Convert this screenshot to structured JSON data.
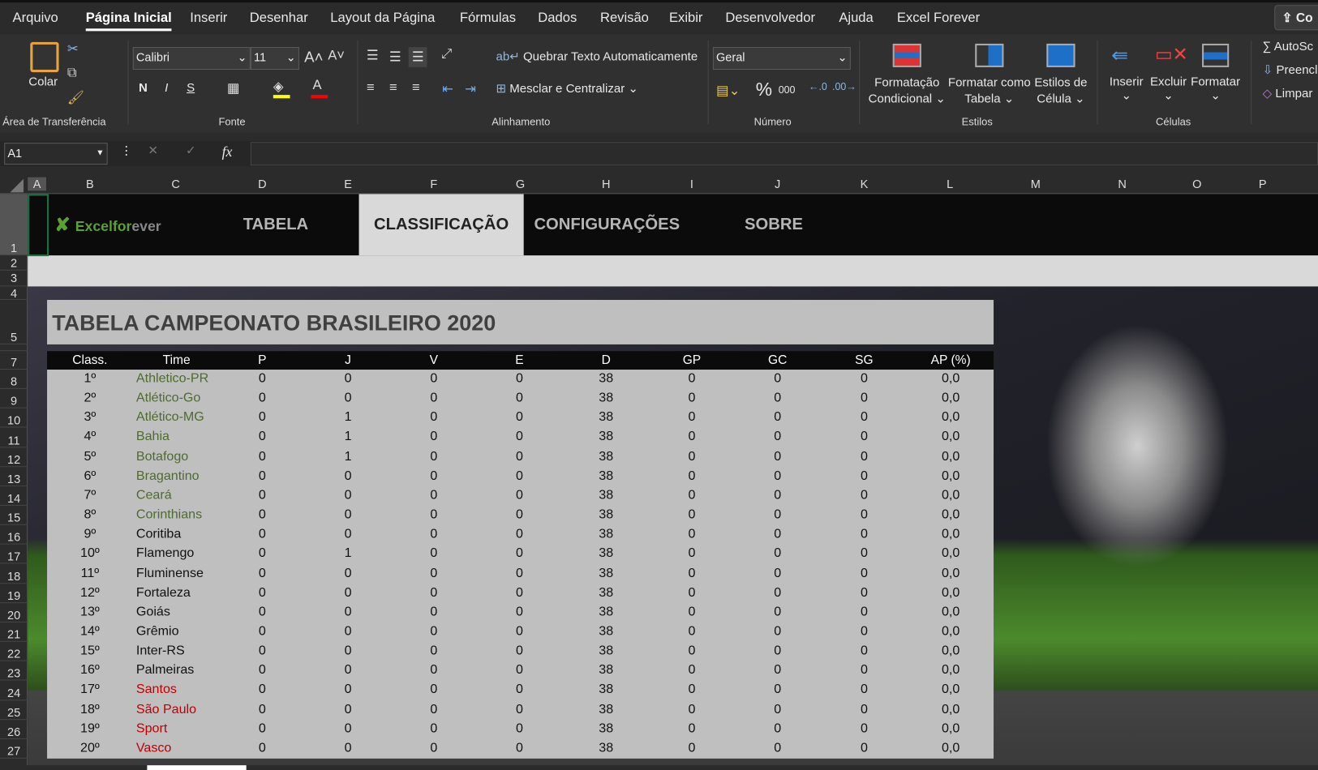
{
  "menu": {
    "items": [
      "Arquivo",
      "Página Inicial",
      "Inserir",
      "Desenhar",
      "Layout da Página",
      "Fórmulas",
      "Dados",
      "Revisão",
      "Exibir",
      "Desenvolvedor",
      "Ajuda",
      "Excel Forever"
    ],
    "active": "Página Inicial",
    "share_label": "Co"
  },
  "ribbon": {
    "clipboard": {
      "paste_label": "Colar",
      "group_label": "Área de Transferência"
    },
    "font": {
      "font_name": "Calibri",
      "font_size": "11",
      "bold": "N",
      "italic": "I",
      "underline": "S",
      "group_label": "Fonte",
      "highlight_color": "#ffff00",
      "font_color": "#ff0000"
    },
    "alignment": {
      "wrap_text": "Quebrar Texto Automaticamente",
      "merge_center": "Mesclar e Centralizar",
      "group_label": "Alinhamento"
    },
    "number": {
      "format": "Geral",
      "percent": "%",
      "thousands": "000",
      "group_label": "Número"
    },
    "styles": {
      "conditional": [
        "Formatação",
        "Condicional"
      ],
      "format_table": [
        "Formatar como",
        "Tabela"
      ],
      "cell_styles": [
        "Estilos de",
        "Célula"
      ],
      "group_label": "Estilos"
    },
    "cells": {
      "insert": "Inserir",
      "delete": "Excluir",
      "format": "Formatar",
      "group_label": "Células"
    },
    "editing": {
      "autosum": "AutoSc",
      "fill": "Preencl",
      "clear": "Limpar"
    }
  },
  "formula_bar": {
    "name_box": "A1",
    "fx": "fx",
    "value": ""
  },
  "columns": [
    "A",
    "B",
    "C",
    "D",
    "E",
    "F",
    "G",
    "H",
    "I",
    "J",
    "K",
    "L",
    "M",
    "N",
    "O",
    "P"
  ],
  "rows": [
    "1",
    "2",
    "3",
    "4",
    "5",
    "",
    "7",
    "8",
    "9",
    "10",
    "11",
    "12",
    "13",
    "14",
    "15",
    "16",
    "17",
    "18",
    "19",
    "20",
    "21",
    "22",
    "23",
    "24",
    "25",
    "26",
    "27"
  ],
  "sheet": {
    "logo": {
      "part1": "Excelfor",
      "part2": "ever"
    },
    "nav": [
      "TABELA",
      "CLASSIFICAÇÃO",
      "CONFIGURAÇÕES",
      "SOBRE"
    ],
    "nav_active": "CLASSIFICAÇÃO",
    "title": "TABELA CAMPEONATO BRASILEIRO 2020",
    "headers": [
      "Class.",
      "Time",
      "P",
      "J",
      "V",
      "E",
      "D",
      "GP",
      "GC",
      "SG",
      "AP (%)"
    ],
    "colors": {
      "green": "#4e6b2e",
      "black": "#111111",
      "red": "#c00000"
    },
    "table": [
      {
        "pos": "1º",
        "team": "Athletico-PR",
        "zone": "green",
        "v": [
          "0",
          "0",
          "0",
          "0",
          "38",
          "0",
          "0",
          "0",
          "0,0"
        ]
      },
      {
        "pos": "2º",
        "team": "Atlético-Go",
        "zone": "green",
        "v": [
          "0",
          "0",
          "0",
          "0",
          "38",
          "0",
          "0",
          "0",
          "0,0"
        ]
      },
      {
        "pos": "3º",
        "team": "Atlético-MG",
        "zone": "green",
        "v": [
          "0",
          "1",
          "0",
          "0",
          "38",
          "0",
          "0",
          "0",
          "0,0"
        ]
      },
      {
        "pos": "4º",
        "team": "Bahia",
        "zone": "green",
        "v": [
          "0",
          "1",
          "0",
          "0",
          "38",
          "0",
          "0",
          "0",
          "0,0"
        ]
      },
      {
        "pos": "5º",
        "team": "Botafogo",
        "zone": "green",
        "v": [
          "0",
          "1",
          "0",
          "0",
          "38",
          "0",
          "0",
          "0",
          "0,0"
        ]
      },
      {
        "pos": "6º",
        "team": "Bragantino",
        "zone": "green",
        "v": [
          "0",
          "0",
          "0",
          "0",
          "38",
          "0",
          "0",
          "0",
          "0,0"
        ]
      },
      {
        "pos": "7º",
        "team": "Ceará",
        "zone": "green",
        "v": [
          "0",
          "0",
          "0",
          "0",
          "38",
          "0",
          "0",
          "0",
          "0,0"
        ]
      },
      {
        "pos": "8º",
        "team": "Corinthians",
        "zone": "green",
        "v": [
          "0",
          "0",
          "0",
          "0",
          "38",
          "0",
          "0",
          "0",
          "0,0"
        ]
      },
      {
        "pos": "9º",
        "team": "Coritiba",
        "zone": "black",
        "v": [
          "0",
          "0",
          "0",
          "0",
          "38",
          "0",
          "0",
          "0",
          "0,0"
        ]
      },
      {
        "pos": "10º",
        "team": "Flamengo",
        "zone": "black",
        "v": [
          "0",
          "1",
          "0",
          "0",
          "38",
          "0",
          "0",
          "0",
          "0,0"
        ]
      },
      {
        "pos": "11º",
        "team": "Fluminense",
        "zone": "black",
        "v": [
          "0",
          "0",
          "0",
          "0",
          "38",
          "0",
          "0",
          "0",
          "0,0"
        ]
      },
      {
        "pos": "12º",
        "team": "Fortaleza",
        "zone": "black",
        "v": [
          "0",
          "0",
          "0",
          "0",
          "38",
          "0",
          "0",
          "0",
          "0,0"
        ]
      },
      {
        "pos": "13º",
        "team": "Goiás",
        "zone": "black",
        "v": [
          "0",
          "0",
          "0",
          "0",
          "38",
          "0",
          "0",
          "0",
          "0,0"
        ]
      },
      {
        "pos": "14º",
        "team": "Grêmio",
        "zone": "black",
        "v": [
          "0",
          "0",
          "0",
          "0",
          "38",
          "0",
          "0",
          "0",
          "0,0"
        ]
      },
      {
        "pos": "15º",
        "team": "Inter-RS",
        "zone": "black",
        "v": [
          "0",
          "0",
          "0",
          "0",
          "38",
          "0",
          "0",
          "0",
          "0,0"
        ]
      },
      {
        "pos": "16º",
        "team": "Palmeiras",
        "zone": "black",
        "v": [
          "0",
          "0",
          "0",
          "0",
          "38",
          "0",
          "0",
          "0",
          "0,0"
        ]
      },
      {
        "pos": "17º",
        "team": "Santos",
        "zone": "red",
        "v": [
          "0",
          "0",
          "0",
          "0",
          "38",
          "0",
          "0",
          "0",
          "0,0"
        ]
      },
      {
        "pos": "18º",
        "team": "São Paulo",
        "zone": "red",
        "v": [
          "0",
          "0",
          "0",
          "0",
          "38",
          "0",
          "0",
          "0",
          "0,0"
        ]
      },
      {
        "pos": "19º",
        "team": "Sport",
        "zone": "red",
        "v": [
          "0",
          "0",
          "0",
          "0",
          "38",
          "0",
          "0",
          "0",
          "0,0"
        ]
      },
      {
        "pos": "20º",
        "team": "Vasco",
        "zone": "red",
        "v": [
          "0",
          "0",
          "0",
          "0",
          "38",
          "0",
          "0",
          "0",
          "0,0"
        ]
      }
    ]
  }
}
